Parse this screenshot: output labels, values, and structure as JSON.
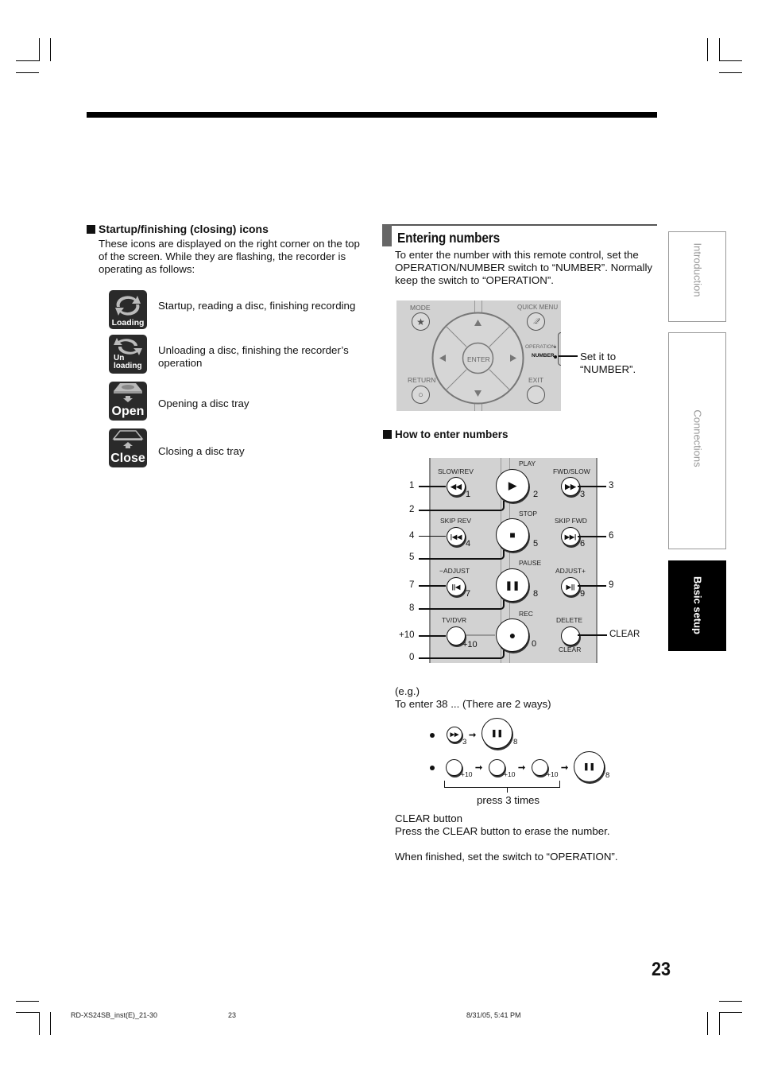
{
  "left_section": {
    "heading": "Startup/finishing (closing) icons",
    "intro": "These icons are displayed on the right corner on the top of the screen. While they are flashing, the recorder is operating as follows:",
    "icons": [
      {
        "icon": "loading-icon",
        "label": "Loading",
        "description": "Startup, reading a disc, finishing recording"
      },
      {
        "icon": "unloading-icon",
        "label_line1": "Un",
        "label_line2": "loading",
        "description": "Unloading a disc, finishing the recorder’s operation"
      },
      {
        "icon": "open-tray-icon",
        "label": "Open",
        "description": "Opening a disc tray"
      },
      {
        "icon": "close-tray-icon",
        "label": "Close",
        "description": "Closing a disc tray"
      }
    ]
  },
  "right_section": {
    "title": "Entering numbers",
    "intro": "To enter the number with this remote control, set the OPERATION/NUMBER switch to “NUMBER”. Normally keep the switch to “OPERATION”.",
    "remote": {
      "mode": "MODE",
      "quick_menu": "QUICK MENU",
      "enter": "ENTER",
      "return": "RETURN",
      "exit": "EXIT",
      "operation": "OPERATION",
      "number": "NUMBER",
      "callout_line1": "Set it to",
      "callout_line2": "“NUMBER”."
    },
    "how_heading": "How to enter numbers",
    "buttons": {
      "slow_rev": "SLOW/REV",
      "play": "PLAY",
      "fwd_slow": "FWD/SLOW",
      "skip_rev": "SKIP REV",
      "stop": "STOP",
      "skip_fwd": "SKIP FWD",
      "adjust_minus": "−ADJUST",
      "pause": "PAUSE",
      "adjust_plus": "ADJUST+",
      "tv_dvr": "TV/DVR",
      "rec": "REC",
      "delete": "DELETE",
      "clear": "CLEAR"
    },
    "digits": {
      "d1": "1",
      "d2": "2",
      "d3": "3",
      "d4": "4",
      "d5": "5",
      "d6": "6",
      "d7": "7",
      "d8": "8",
      "d9": "9",
      "d0": "0",
      "plus10": "+10",
      "clear": "CLEAR"
    },
    "example": {
      "eg": "(e.g.)",
      "line": "To enter 38 ... (There are 2 ways)",
      "sub3": "3",
      "sub8": "8",
      "sub10": "+10",
      "press": "press 3 times"
    },
    "clear_heading": "CLEAR button",
    "clear_text": "Press the CLEAR button to erase the number.",
    "finish_text": "When finished, set the switch to “OPERATION”."
  },
  "side_tabs": [
    {
      "label": "Introduction",
      "active": false
    },
    {
      "label": "Connections",
      "active": false
    },
    {
      "label": "Basic setup",
      "active": true
    }
  ],
  "page_number": "23",
  "footer": {
    "file": "RD-XS24SB_inst(E)_21-30",
    "page": "23",
    "date": "8/31/05, 5:41 PM"
  }
}
